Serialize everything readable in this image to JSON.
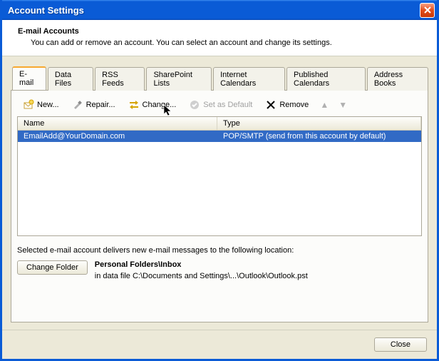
{
  "window": {
    "title": "Account Settings"
  },
  "header": {
    "heading": "E-mail Accounts",
    "subtext": "You can add or remove an account. You can select an account and change its settings."
  },
  "tabs": [
    {
      "label": "E-mail",
      "active": true
    },
    {
      "label": "Data Files",
      "active": false
    },
    {
      "label": "RSS Feeds",
      "active": false
    },
    {
      "label": "SharePoint Lists",
      "active": false
    },
    {
      "label": "Internet Calendars",
      "active": false
    },
    {
      "label": "Published Calendars",
      "active": false
    },
    {
      "label": "Address Books",
      "active": false
    }
  ],
  "toolbar": {
    "new_label": "New...",
    "repair_label": "Repair...",
    "change_label": "Change...",
    "setdefault_label": "Set as Default",
    "remove_label": "Remove"
  },
  "list": {
    "columns": {
      "name": "Name",
      "type": "Type"
    },
    "rows": [
      {
        "name": "EmailAdd@YourDomain.com",
        "type": "POP/SMTP (send from this account by default)"
      }
    ]
  },
  "delivery": {
    "text": "Selected e-mail account delivers new e-mail messages to the following location:",
    "change_folder_label": "Change Folder",
    "folder_path": "Personal Folders\\Inbox",
    "data_file": "in data file C:\\Documents and Settings\\...\\Outlook\\Outlook.pst"
  },
  "footer": {
    "close_label": "Close"
  }
}
